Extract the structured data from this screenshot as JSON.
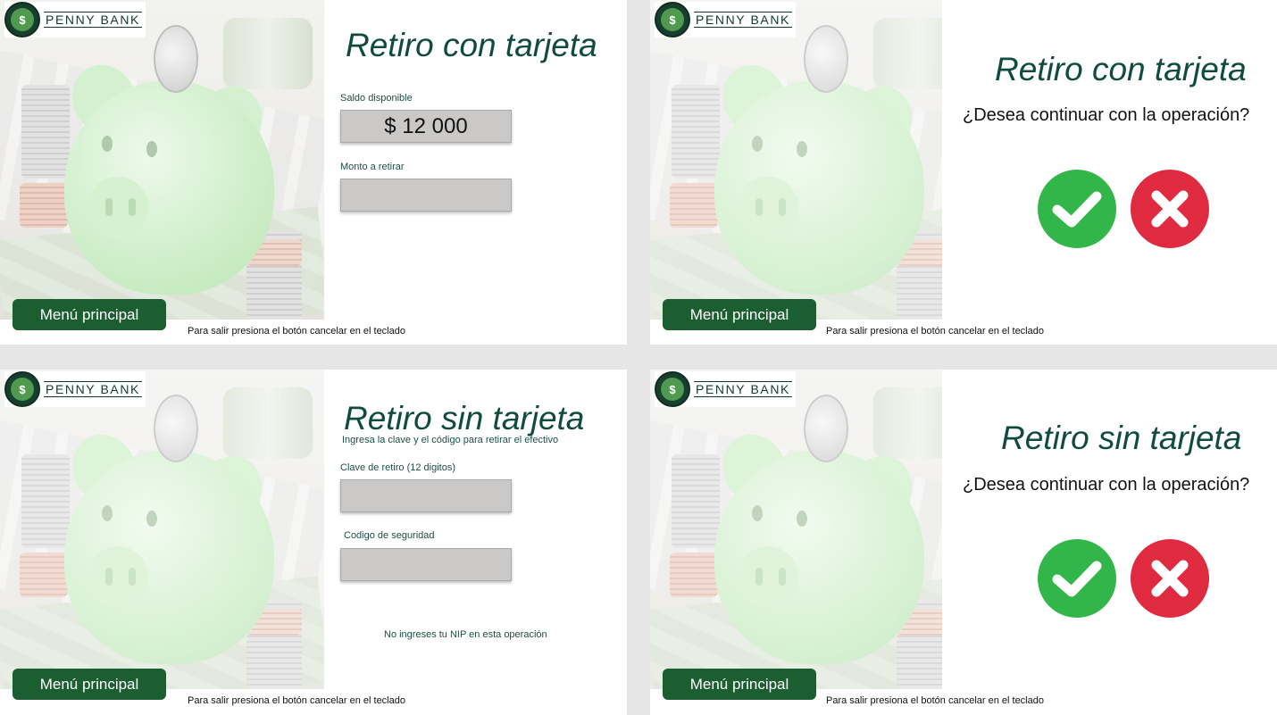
{
  "brand": {
    "name": "PENNY BANK",
    "mark": "$"
  },
  "colors": {
    "title": "#0f4c3f",
    "menu_button": "#1b5e30",
    "accept": "#32b64a",
    "cancel": "#df2a3f",
    "field": "#cbc9c7"
  },
  "panels": [
    {
      "title": "Retiro con tarjeta",
      "balance_label": "Saldo disponible",
      "balance_value": "$ 12 000",
      "amount_label": "Monto a retirar",
      "amount_value": "",
      "menu_label": "Menú principal",
      "footer": "Para salir presiona el botón cancelar en el teclado"
    },
    {
      "title": "Retiro con tarjeta",
      "question": "¿Desea continuar con la operación?",
      "accept_icon": "check-icon",
      "cancel_icon": "x-icon",
      "menu_label": "Menú principal",
      "footer": "Para salir presiona el botón cancelar en el teclado"
    },
    {
      "title": "Retiro sin tarjeta",
      "subtitle": "Ingresa la clave y el código para retirar el efectivo",
      "code_label": "Clave de retiro (12 digitos)",
      "code_value": "",
      "security_label": "Codigo de seguridad",
      "security_value": "",
      "notice": "No ingreses tu NIP en esta operación",
      "menu_label": "Menú principal",
      "footer": "Para salir presiona el botón cancelar en el teclado"
    },
    {
      "title": "Retiro sin tarjeta",
      "question": "¿Desea continuar con la operación?",
      "accept_icon": "check-icon",
      "cancel_icon": "x-icon",
      "menu_label": "Menú principal",
      "footer": "Para salir presiona el botón cancelar en el teclado"
    }
  ]
}
